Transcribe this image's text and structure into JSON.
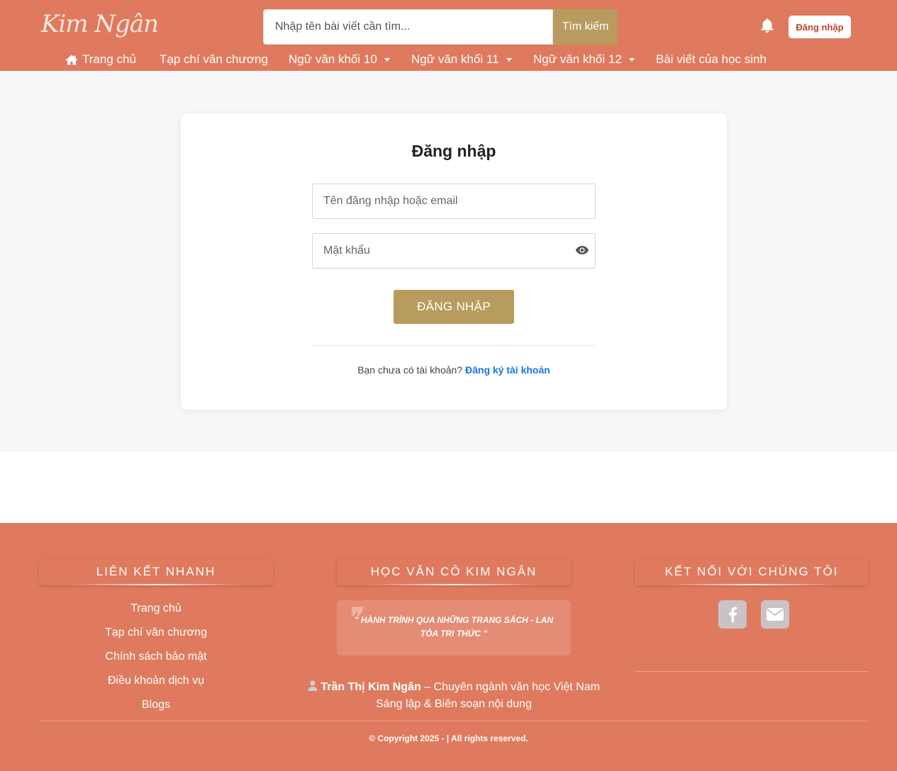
{
  "header": {
    "logo_text": "Kim Ngân",
    "search_placeholder": "Nhập tên bài viết cần tìm...",
    "search_button": "Tìm kiếm",
    "login_button": "Đăng nhập",
    "nav": [
      {
        "label": "Trang chủ",
        "icon": "home-icon"
      },
      {
        "label": "Tạp chí văn chương"
      },
      {
        "label": "Ngữ văn khối 10",
        "dropdown": true
      },
      {
        "label": "Ngữ văn khối 11",
        "dropdown": true
      },
      {
        "label": "Ngữ văn khối 12",
        "dropdown": true
      },
      {
        "label": "Bài viết của học sinh"
      }
    ]
  },
  "login": {
    "title": "Đăng nhập",
    "username_placeholder": "Tên đăng nhập hoặc email",
    "password_placeholder": "Mật khẩu",
    "submit": "ĐĂNG NHẬP",
    "no_account": "Bạn chưa có tài khoản?",
    "register_link": "Đăng ký tài khoản"
  },
  "footer": {
    "quick_links_title": "LIÊN KẾT NHANH",
    "quick_links": [
      "Trang chủ",
      "Tạp chí văn chương",
      "Chính sách bảo mật",
      "Điều khoản dịch vụ",
      "Blogs"
    ],
    "about_title": "HỌC VĂN CÔ KIM NGÂN",
    "quote": "\" HÀNH TRÌNH QUA NHỮNG TRANG SÁCH - LAN TỎA TRI THỨC \"",
    "author_name": "Trần Thị Kim Ngân",
    "author_role": "– Chuyên ngành văn học Việt Nam",
    "author_line2": "Sáng lập & Biên soạn nội dung",
    "connect_title": "KẾT NỐI VỚI CHÚNG TÔI",
    "copyright": "© Copyright 2025 - | All rights reserved."
  },
  "colors": {
    "primary": "#e07a5f",
    "accent_gold": "#b89b5e",
    "link_blue": "#1a73e8",
    "page_bg": "#f7f8fa"
  }
}
